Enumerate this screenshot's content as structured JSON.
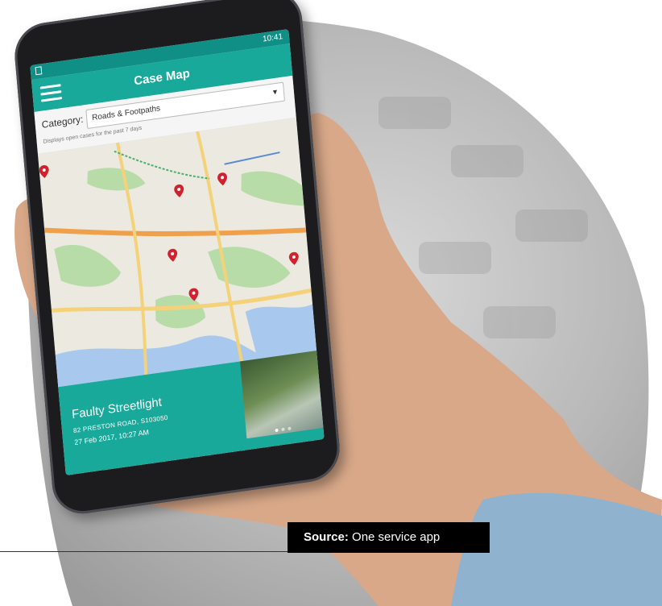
{
  "status_bar": {
    "time": "10:41"
  },
  "app": {
    "title": "Case Map"
  },
  "filter": {
    "category_label": "Category:",
    "category_value": "Roads & Footpaths",
    "hint": "Displays open cases for the past 7 days"
  },
  "case_card": {
    "title": "Faulty Streetlight",
    "address": "82 PRESTON ROAD, S103050",
    "datetime": "27 Feb 2017, 10:27 AM"
  },
  "source": {
    "label": "Source:",
    "text": "One service app"
  },
  "colors": {
    "teal": "#18a99b",
    "teal_dark": "#0f8f86",
    "pin": "#d2202e"
  },
  "icons": {
    "menu": "hamburger-icon",
    "pin": "map-pin-icon"
  }
}
